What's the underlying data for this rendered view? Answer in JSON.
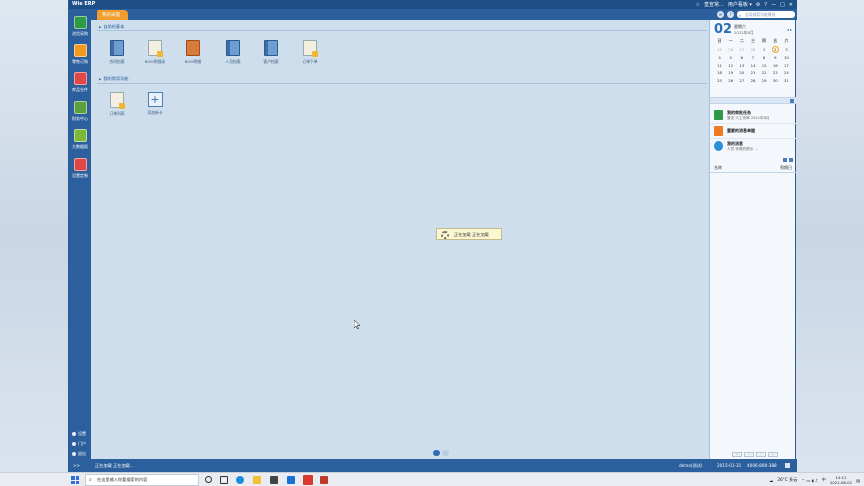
{
  "window": {
    "title": "Wie ERP",
    "top_right": [
      "☆",
      "皇宣常... ",
      "用户看板 ▾",
      "⚙",
      "?",
      "—",
      "□",
      "✕"
    ]
  },
  "tabs": [
    {
      "label": "我的卓面"
    }
  ],
  "search": {
    "placeholder": "全局搜索功能模块"
  },
  "leftnav": {
    "items": [
      {
        "label": "进货采购",
        "color": "#2f9a45"
      },
      {
        "label": "零售订购",
        "color": "#f09a1f"
      },
      {
        "label": "库品仓件",
        "color": "#e04848"
      },
      {
        "label": "财务中心",
        "color": "#5aa13e"
      },
      {
        "label": "大数据报",
        "color": "#7bb83a"
      },
      {
        "label": "设置定制",
        "color": "#e04848"
      }
    ],
    "bottom": [
      {
        "label": "设置"
      },
      {
        "label": "门户"
      },
      {
        "label": "退出"
      }
    ],
    "collapse": ">>"
  },
  "main": {
    "section1": {
      "title": "自助的基本"
    },
    "icons1": [
      {
        "label": "合同档案",
        "kind": "book"
      },
      {
        "label": "BOM明细录",
        "kind": "doc"
      },
      {
        "label": "BOM明细",
        "kind": "clip"
      },
      {
        "label": "人员档案",
        "kind": "book"
      },
      {
        "label": "客户档案",
        "kind": "book"
      },
      {
        "label": "订单下单",
        "kind": "doc"
      }
    ],
    "section2": {
      "title": "我的常用功能"
    },
    "icons2": [
      {
        "label": "订单列表",
        "kind": "doc"
      },
      {
        "label": "添加新卡",
        "kind": "plus"
      }
    ],
    "loading": "正在加载 正在加载"
  },
  "calendar": {
    "day": "02",
    "weekday": "星期六",
    "month": "2021年8月",
    "nav": "◂ ▸",
    "headers": [
      "日",
      "一",
      "二",
      "三",
      "四",
      "五",
      "六"
    ],
    "rows": [
      [
        "25",
        "26",
        "27",
        "28",
        "1",
        "2",
        "3"
      ],
      [
        "4",
        "5",
        "6",
        "7",
        "8",
        "9",
        "10"
      ],
      [
        "11",
        "12",
        "13",
        "14",
        "15",
        "16",
        "17"
      ],
      [
        "18",
        "19",
        "20",
        "21",
        "22",
        "23",
        "24"
      ],
      [
        "25",
        "26",
        "27",
        "28",
        "29",
        "30",
        "31"
      ]
    ]
  },
  "messages": [
    {
      "title": "我的审批任务",
      "sub": "暂无 人工待审 2021年8月",
      "color": "#2f9a45"
    },
    {
      "title": "重要的消息单据",
      "sub": "",
      "color": "#f07a1f"
    },
    {
      "title": "我的消息",
      "sub": "人员 作用的提示 ...",
      "color": "#2b8fd8"
    }
  ],
  "rp_list": {
    "left": "名称",
    "right": "到期日"
  },
  "statusbar": {
    "left": "正在加载 正在加载...",
    "user": "demo(测试)",
    "date": "2015-01-31",
    "phone": "4006-800-388"
  },
  "taskbar": {
    "search": "在这里输入你要搜索的内容",
    "weather": "26°C 多云",
    "time": "14:11",
    "date": "2021-08-02",
    "lang": "中"
  }
}
